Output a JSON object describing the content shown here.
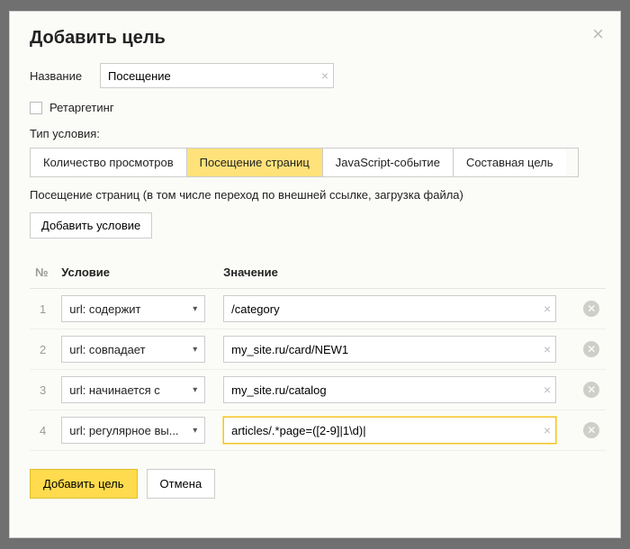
{
  "modal": {
    "title": "Добавить цель",
    "name_label": "Название",
    "name_value": "Посещение",
    "retargeting_label": "Ретаргетинг",
    "retargeting_checked": false,
    "type_label": "Тип условия:",
    "tabs": [
      {
        "label": "Количество просмотров",
        "active": false
      },
      {
        "label": "Посещение страниц",
        "active": true
      },
      {
        "label": "JavaScript-событие",
        "active": false
      },
      {
        "label": "Составная цель",
        "active": false
      }
    ],
    "description": "Посещение страниц (в том числе переход по внешней ссылке, загрузка файла)",
    "add_condition_label": "Добавить условие",
    "table": {
      "col_num": "№",
      "col_condition": "Условие",
      "col_value": "Значение"
    },
    "rows": [
      {
        "num": "1",
        "condition": "url: содержит",
        "value": "/category",
        "highlight": false
      },
      {
        "num": "2",
        "condition": "url: совпадает",
        "value": "my_site.ru/card/NEW1",
        "highlight": false
      },
      {
        "num": "3",
        "condition": "url: начинается с",
        "value": "my_site.ru/catalog",
        "highlight": false
      },
      {
        "num": "4",
        "condition": "url: регулярное вы...",
        "value": "articles/.*page=([2-9]|1\\d)|",
        "highlight": true
      }
    ],
    "footer": {
      "submit": "Добавить цель",
      "cancel": "Отмена"
    }
  }
}
